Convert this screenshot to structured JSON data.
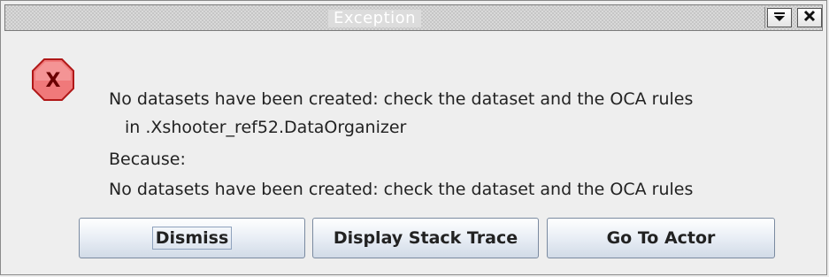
{
  "window": {
    "title": "Exception",
    "menu_icon": "triangle-down-icon",
    "close_icon": "close-icon"
  },
  "dialog": {
    "icon": "error-x-icon",
    "message_lines": [
      "No datasets have been created: check the dataset and the OCA rules",
      "in .Xshooter_ref52.DataOrganizer",
      "Because:",
      "No datasets have been created: check the dataset and the OCA rules"
    ]
  },
  "buttons": {
    "dismiss": "Dismiss",
    "stack_trace": "Display Stack Trace",
    "go_to_actor": "Go To Actor"
  },
  "colors": {
    "icon_fill": "#f0797a",
    "icon_border": "#c02020",
    "icon_x": "#7a0000"
  }
}
